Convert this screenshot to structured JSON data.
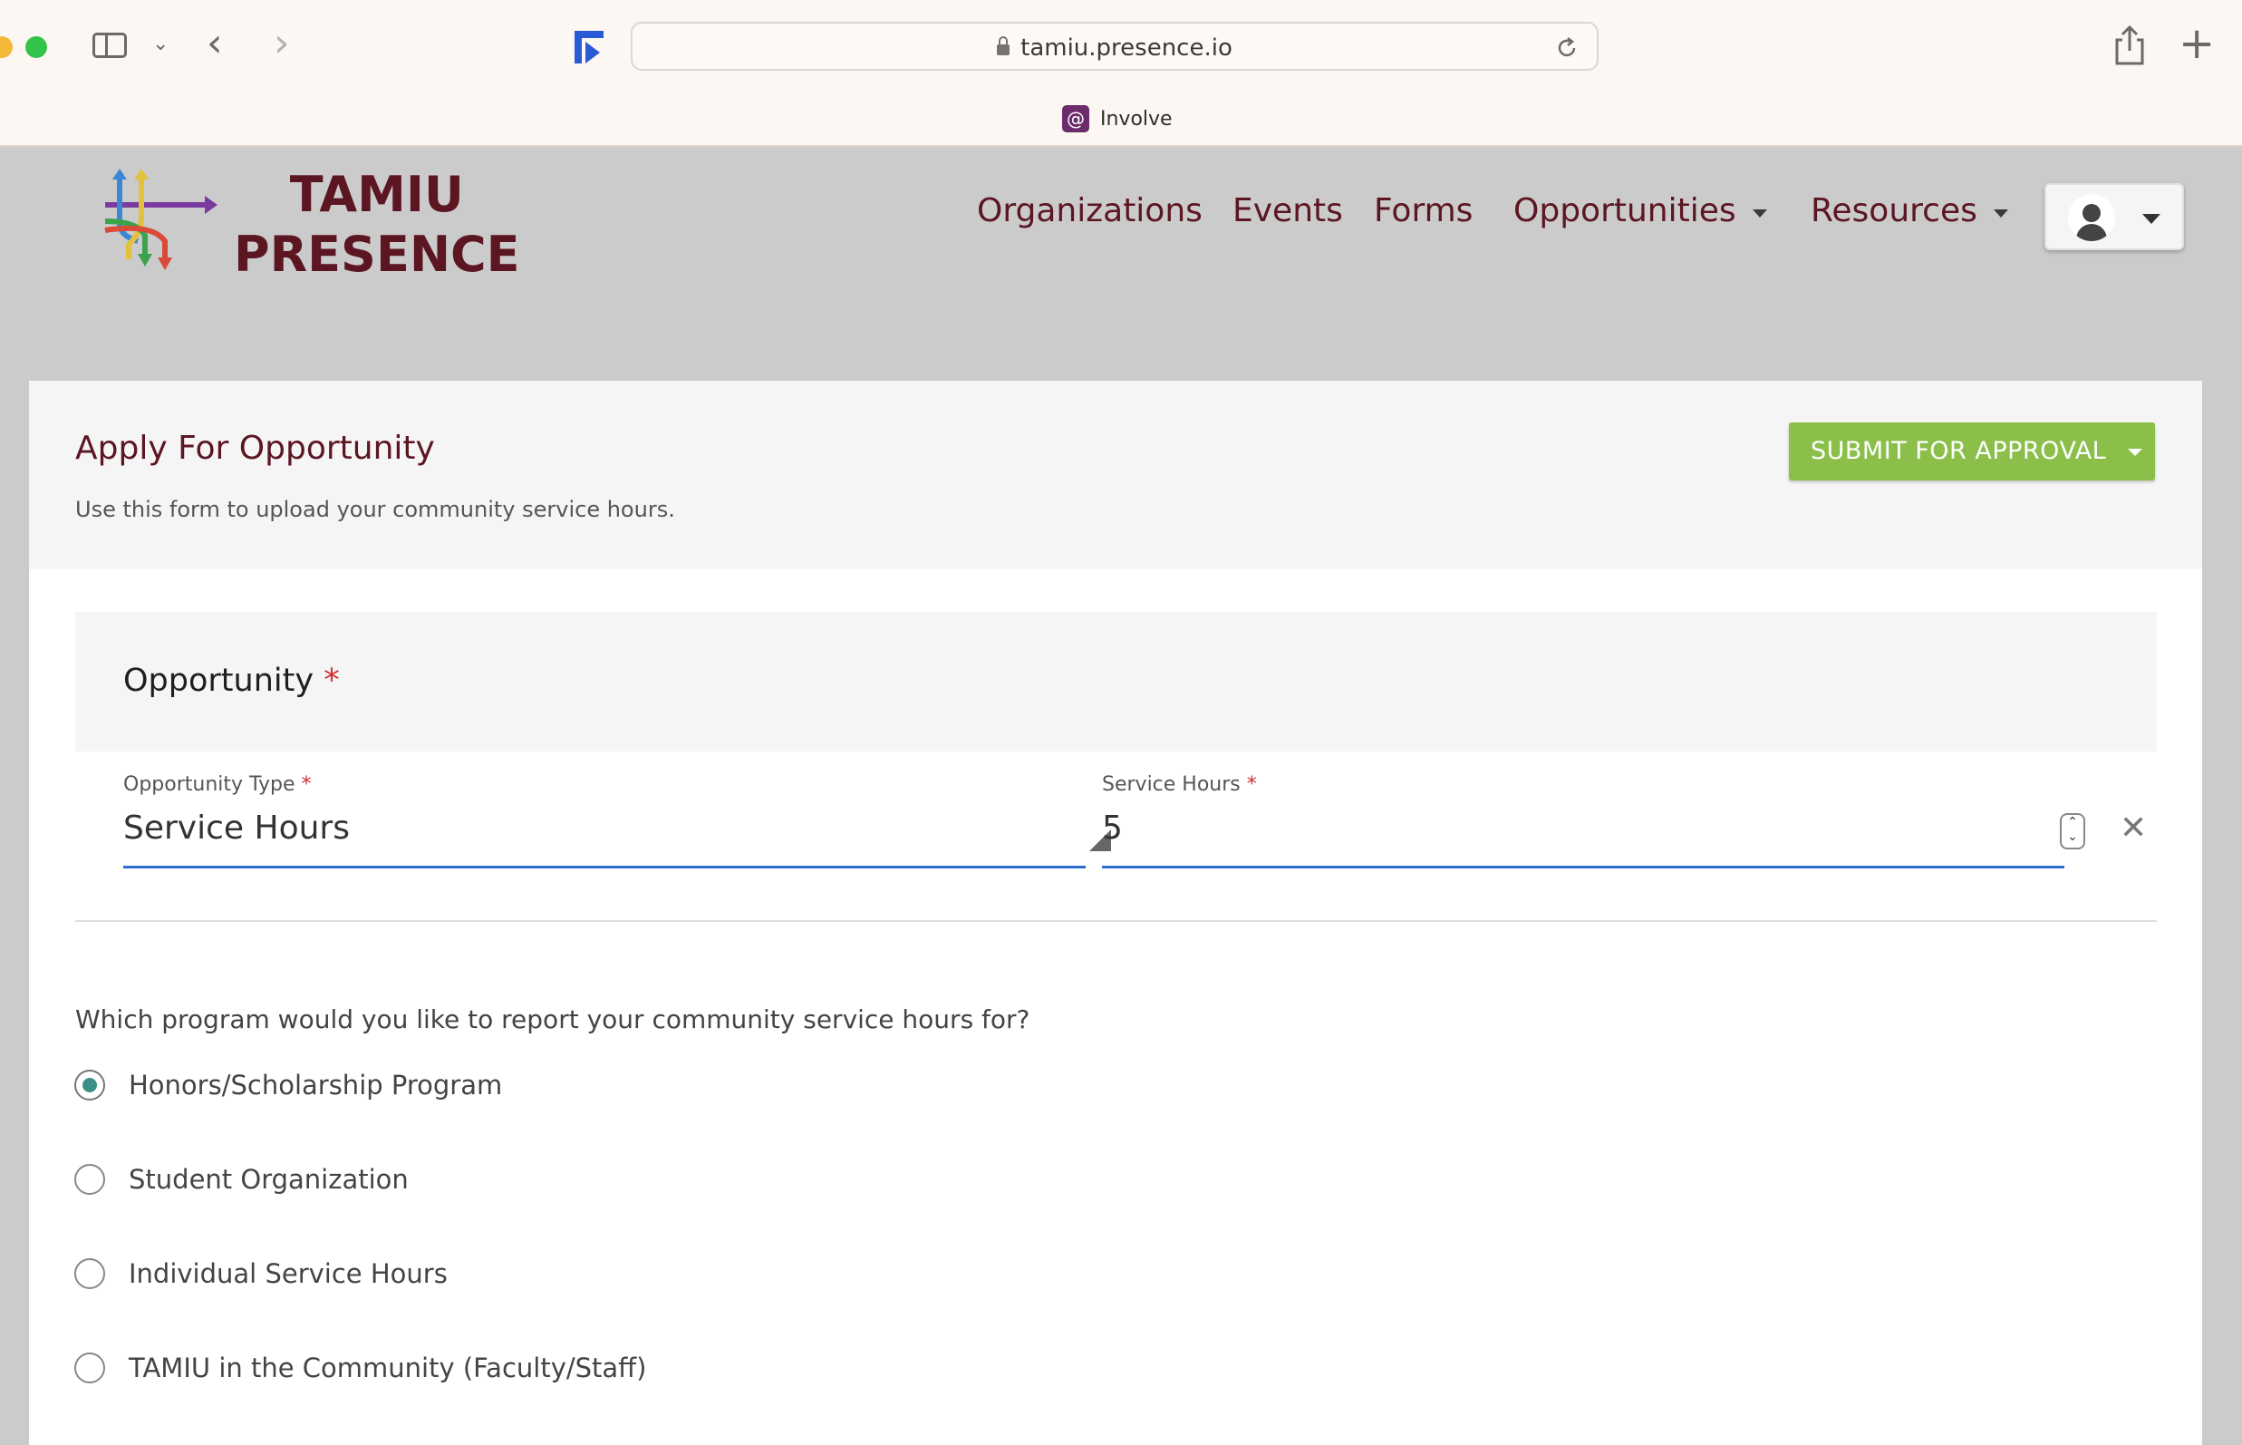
{
  "browser": {
    "url": "tamiu.presence.io",
    "tab_title": "Involve"
  },
  "header": {
    "logo_line1": "TAMIU",
    "logo_line2": "PRESENCE",
    "nav": {
      "organizations": "Organizations",
      "events": "Events",
      "forms": "Forms",
      "opportunities": "Opportunities",
      "resources": "Resources"
    }
  },
  "page": {
    "title": "Apply For Opportunity",
    "subtitle": "Use this form to upload your community service hours.",
    "submit_label": "SUBMIT FOR APPROVAL"
  },
  "opportunity": {
    "section_title": "Opportunity",
    "required_mark": "*",
    "type_label": "Opportunity Type",
    "type_value": "Service Hours",
    "hours_label": "Service Hours",
    "hours_value": "5"
  },
  "question": {
    "text": "Which program would you like to report your community service hours for?",
    "options": [
      {
        "label": "Honors/Scholarship Program",
        "checked": true
      },
      {
        "label": "Student Organization",
        "checked": false
      },
      {
        "label": "Individual Service Hours",
        "checked": false
      },
      {
        "label": "TAMIU in the Community (Faculty/Staff)",
        "checked": false
      }
    ]
  },
  "colors": {
    "brand": "#5c1622",
    "submit": "#8bbf4a",
    "field_underline": "#2d6fd0",
    "radio_checked": "#3b8f86",
    "required": "#d32f2f"
  }
}
